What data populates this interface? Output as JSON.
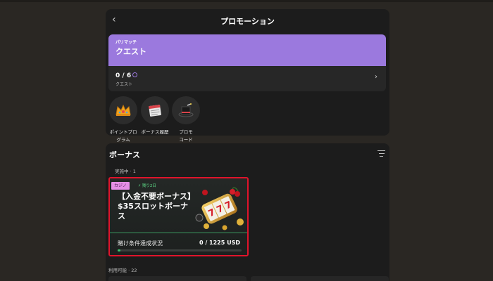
{
  "header": {
    "title": "プロモーション",
    "back_label": "‹"
  },
  "quest": {
    "tag": "パリマッチ",
    "title": "クエスト",
    "progress": "0 / 6",
    "subtitle": "クエスト",
    "arrow": "›"
  },
  "shortcuts": [
    {
      "label_line1": "ポイントプロ",
      "label_line2": "グラム",
      "icon": "crown-icon"
    },
    {
      "label_line1": "ボーナス履歴",
      "label_line2": "",
      "icon": "calendar-icon"
    },
    {
      "label_line1": "プロモ",
      "label_line2": "コード",
      "icon": "magic-hat-icon"
    }
  ],
  "bonus_section": {
    "title": "ボーナス",
    "active_count": "実施中 · 1",
    "available_count": "利用可能 · 22"
  },
  "bonus_card": {
    "category": "カジノ",
    "timer": "残り2日",
    "title_line1": "【入金不要ボーナス】",
    "title_line2": "$35スロットボーナス",
    "wager_label": "賭け条件達成状況",
    "wager_value": "0 / 1225 USD",
    "progress_fraction": 0.0
  },
  "colors": {
    "background": "#2a2723",
    "panel": "#1c1c1c",
    "quest_accent": "#9b79de",
    "highlight_border": "#e0142b",
    "progress_green": "#38c46c",
    "casino_badge": "#e58fe6"
  }
}
